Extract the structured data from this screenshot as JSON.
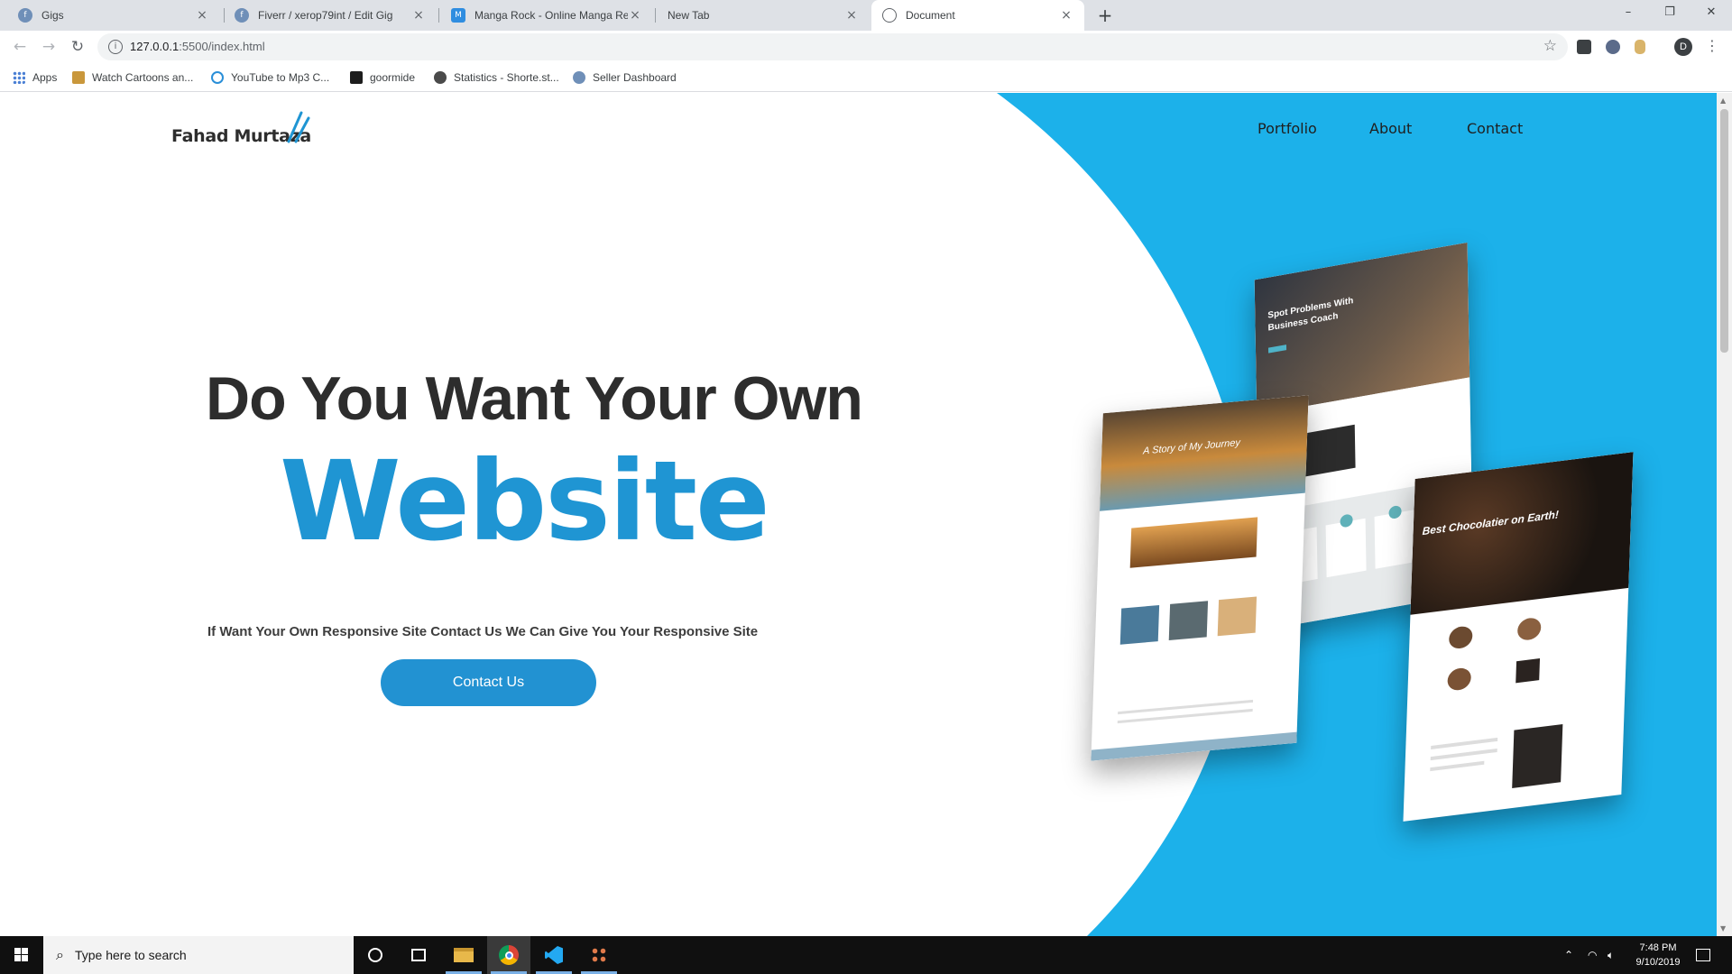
{
  "browser": {
    "tabs": [
      {
        "title": "Gigs",
        "active": false
      },
      {
        "title": "Fiverr / xerop79int / Edit Gig",
        "active": false
      },
      {
        "title": "Manga Rock - Online Manga Rea",
        "active": false
      },
      {
        "title": "New Tab",
        "active": false
      },
      {
        "title": "Document",
        "active": true
      }
    ],
    "url_host": "127.0.0.1",
    "url_rest": ":5500/index.html",
    "profile_initial": "D",
    "bookmarks": [
      {
        "label": "Apps",
        "icon": "apps-grid-icon"
      },
      {
        "label": "Watch Cartoons an...",
        "icon": "cartoon-icon"
      },
      {
        "label": "YouTube to Mp3 C...",
        "icon": "download-icon"
      },
      {
        "label": "goormide",
        "icon": "terminal-icon"
      },
      {
        "label": "Statistics - Shorte.st...",
        "icon": "stats-icon"
      },
      {
        "label": "Seller Dashboard",
        "icon": "fiverr-icon"
      }
    ]
  },
  "page": {
    "brand": "Fahad Murtaza",
    "nav": [
      "Portfolio",
      "About",
      "Contact"
    ],
    "headline": "Do You Want Your Own",
    "headline_emphasis": "Website",
    "subtitle": "If Want Your Own Responsive Site Contact Us We Can Give You Your Responsive Site",
    "cta_label": "Contact Us",
    "mockups": {
      "coach_title": "Spot Problems With Business Coach",
      "journey_title": "A Story of My Journey",
      "chocolate_title": "Best Chocolatier on Earth!"
    },
    "colors": {
      "accent": "#1f95d3",
      "background_blue": "#1cb1ea",
      "button": "#2292d2"
    }
  },
  "taskbar": {
    "search_placeholder": "Type here to search",
    "time": "7:48 PM",
    "date": "9/10/2019"
  }
}
